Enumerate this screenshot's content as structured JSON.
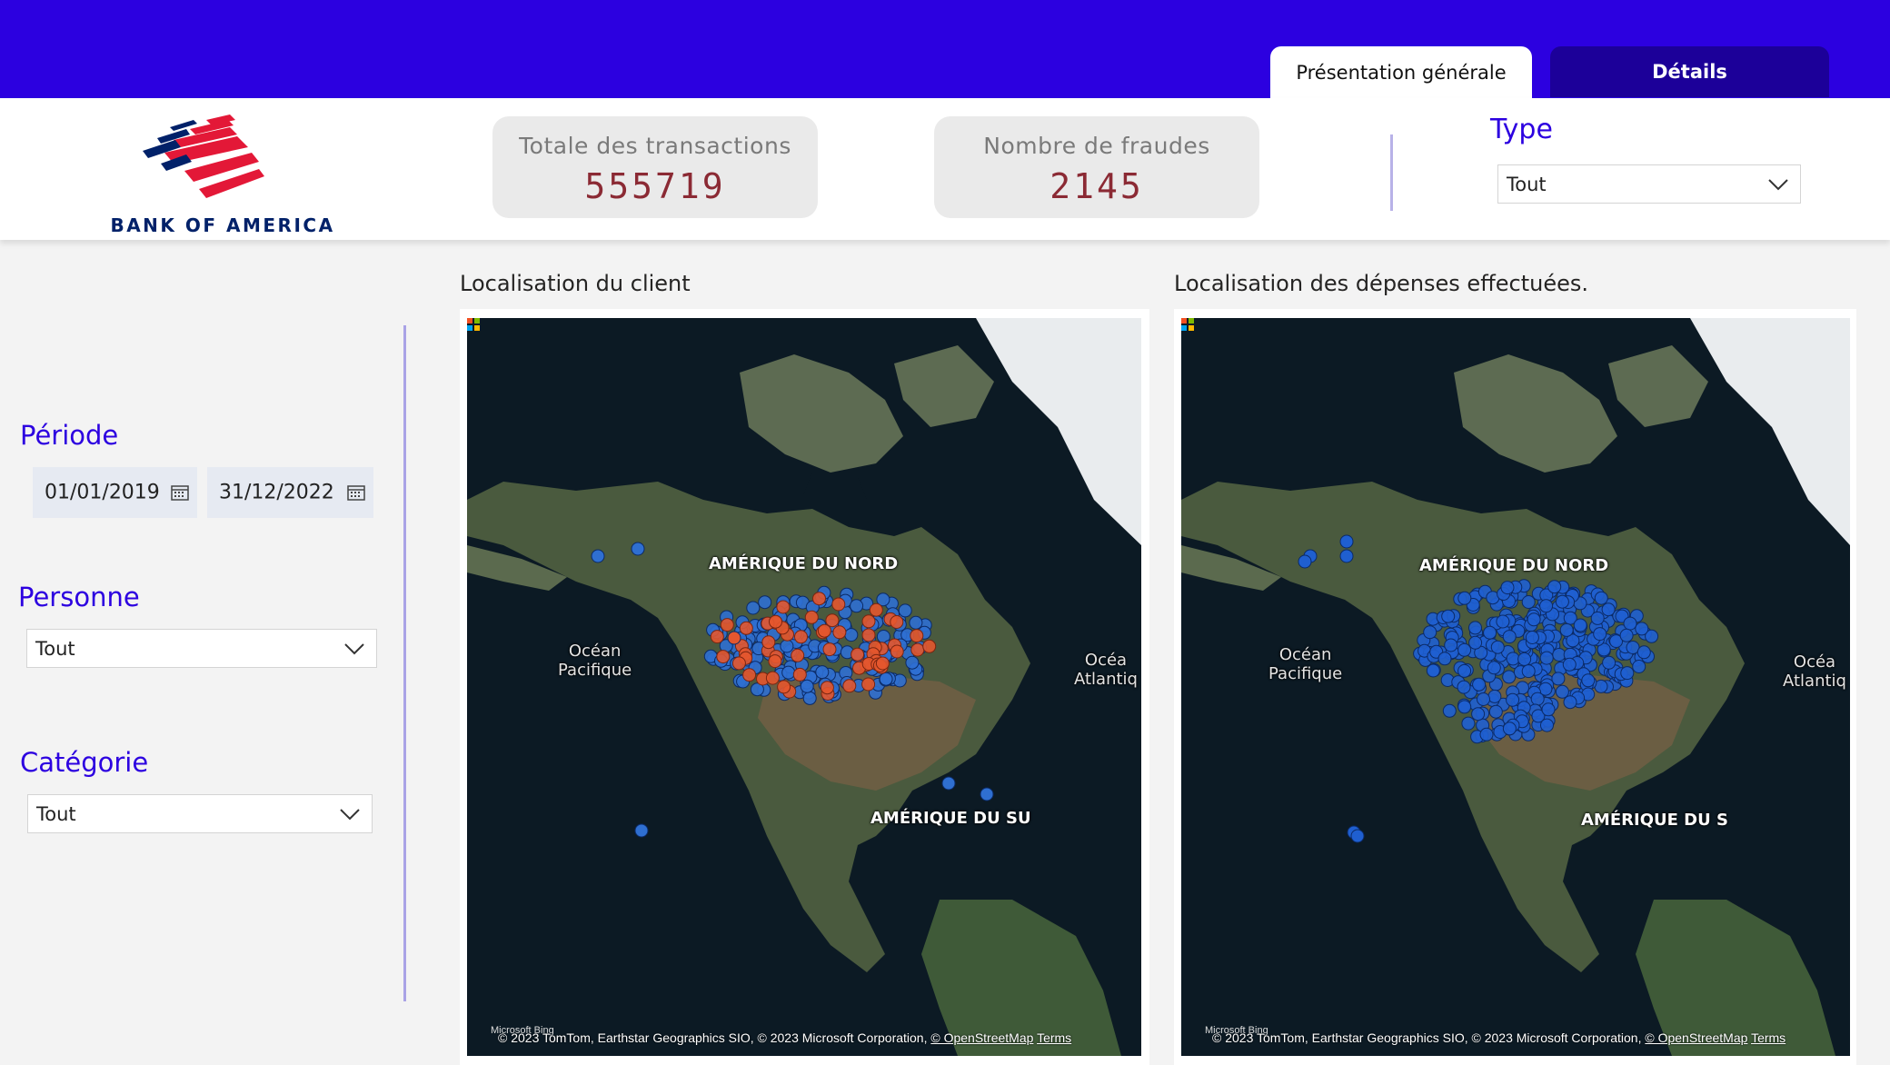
{
  "brand": {
    "name": "BANK OF AMERICA"
  },
  "tabs": [
    {
      "label": "Présentation générale",
      "active": true
    },
    {
      "label": "Détails",
      "active": false
    }
  ],
  "kpis": {
    "transactions": {
      "label": "Totale des transactions",
      "value": "555719"
    },
    "frauds": {
      "label": "Nombre de fraudes",
      "value": "2145"
    }
  },
  "filters": {
    "type": {
      "title": "Type",
      "value": "Tout"
    },
    "period": {
      "title": "Période",
      "start": "01/01/2019",
      "end": "31/12/2022"
    },
    "person": {
      "title": "Personne",
      "value": "Tout"
    },
    "category": {
      "title": "Catégorie",
      "value": "Tout"
    }
  },
  "maps": [
    {
      "title": "Localisation du client",
      "labels": {
        "continent_north": "AMÉRIQUE DU NORD",
        "continent_south": "AMÉRIQUE DU SU",
        "ocean_pacific": "Océan\nPacifique",
        "ocean_atlantic": "Océa\nAtlantiq"
      }
    },
    {
      "title": "Localisation des dépenses effectuées.",
      "labels": {
        "continent_north": "AMÉRIQUE DU NORD",
        "continent_south": "AMÉRIQUE DU S",
        "ocean_pacific": "Océan\nPacifique",
        "ocean_atlantic": "Océa\nAtlantiq"
      }
    }
  ],
  "attribution": {
    "bing": "Microsoft Bing",
    "text": "© 2023 TomTom, Earthstar Geographics SIO, © 2023 Microsoft Corporation,",
    "osm": "© OpenStreetMap",
    "terms": "Terms"
  },
  "colors": {
    "accent": "#2c00e0",
    "kpi_value": "#8b2a34",
    "point_legit": "#2f6fd1",
    "point_fraud": "#e4572e",
    "ocean": "#0c1a24"
  }
}
